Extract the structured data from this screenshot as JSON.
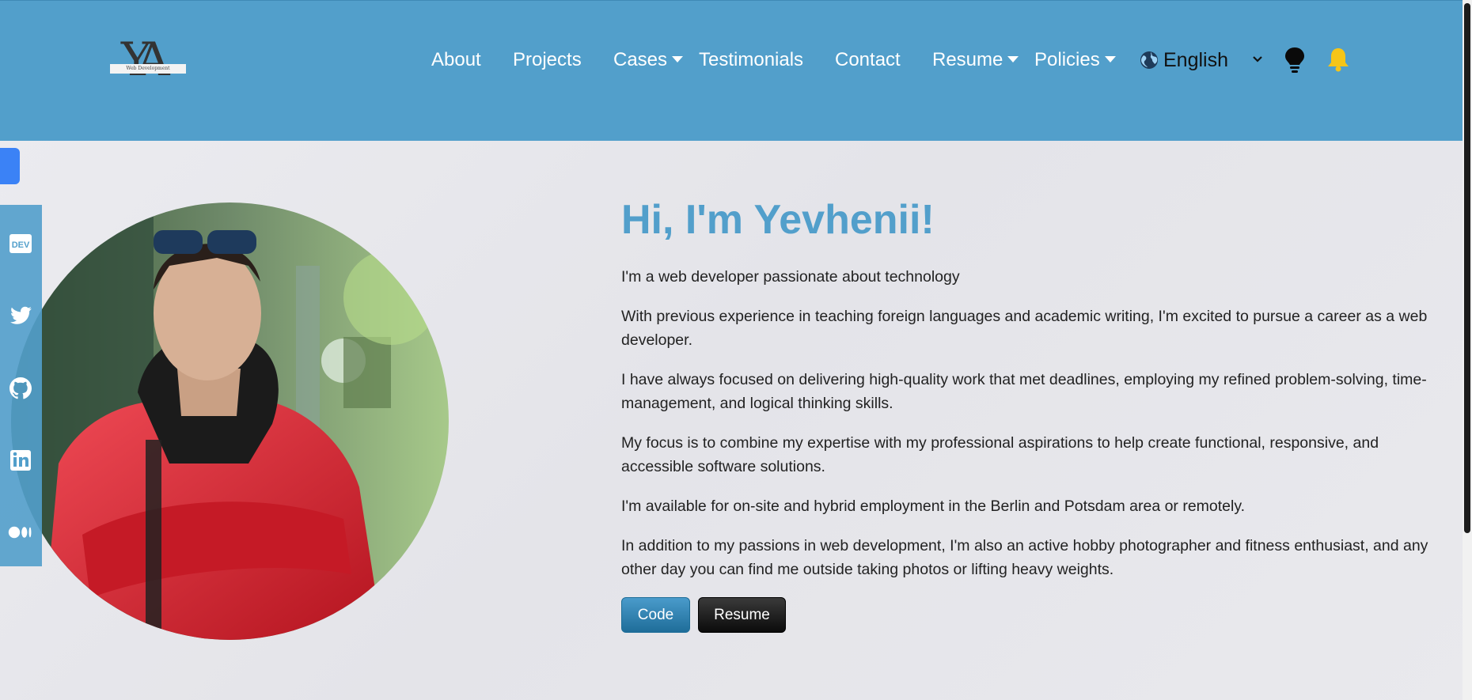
{
  "header": {
    "logo": {
      "letters": "YA",
      "tagline": "Web Development"
    },
    "nav": [
      {
        "label": "About",
        "dropdown": false
      },
      {
        "label": "Projects",
        "dropdown": false
      },
      {
        "label": "Cases",
        "dropdown": true
      },
      {
        "label": "Testimonials",
        "dropdown": false
      },
      {
        "label": "Contact",
        "dropdown": false
      },
      {
        "label": "Resume",
        "dropdown": true
      },
      {
        "label": "Policies",
        "dropdown": true
      }
    ],
    "language": {
      "selected": "English"
    },
    "icons": [
      "globe-icon",
      "lightbulb-icon",
      "bell-icon"
    ],
    "colors": {
      "header_bg": "#529fcb",
      "bell": "#f5c518"
    }
  },
  "social": [
    "dev-icon",
    "twitter-icon",
    "github-icon",
    "linkedin-icon",
    "medium-icon"
  ],
  "main": {
    "title": "Hi, I'm Yevhenii!",
    "paragraphs": [
      "I'm a web developer passionate about technology",
      "With previous experience in teaching foreign languages and academic writing, I'm excited to pursue a career as a web developer.",
      "I have always focused on delivering high-quality work that met deadlines, employing my refined problem-solving, time-management, and logical thinking skills.",
      "My focus is to combine my expertise with my professional aspirations to help create functional, responsive, and accessible software solutions.",
      "I'm available for on-site and hybrid employment in the Berlin and Potsdam area or remotely.",
      "In addition to my passions in web development, I'm also an active hobby photographer and fitness enthusiast, and any other day you can find me outside taking photos or lifting heavy weights."
    ],
    "buttons": {
      "code": "Code",
      "resume": "Resume"
    },
    "accent": "#529fcb"
  }
}
